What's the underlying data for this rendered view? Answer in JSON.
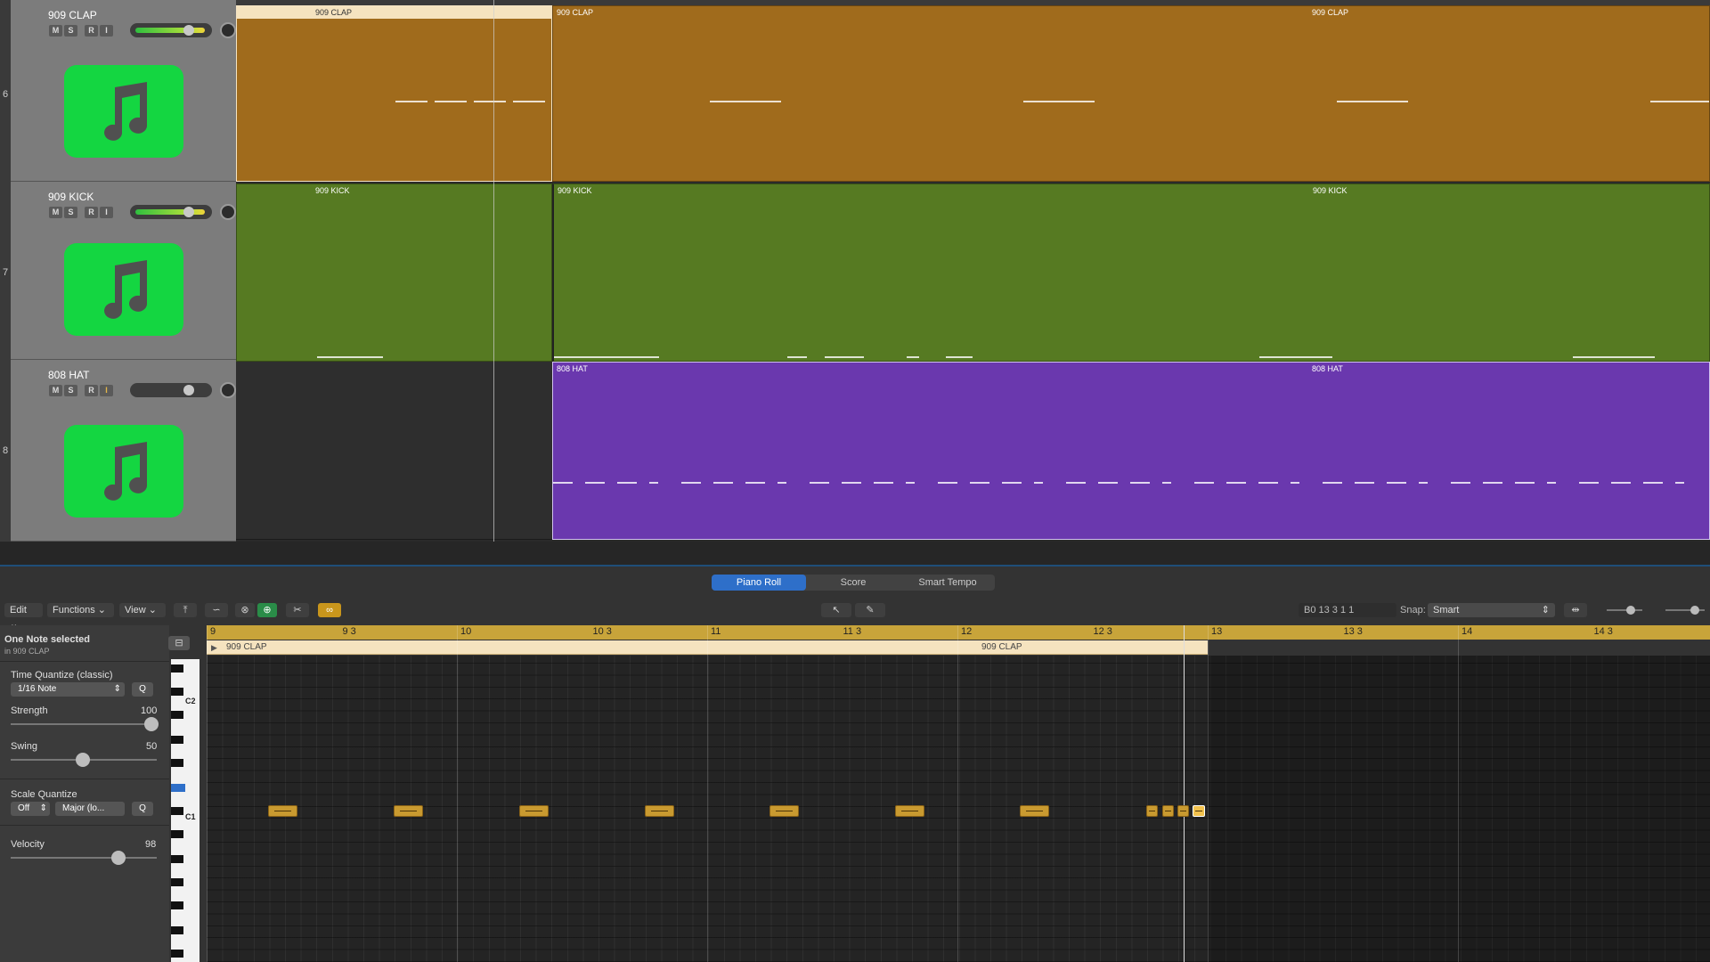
{
  "tracks": [
    {
      "number": "6",
      "name": "909 CLAP",
      "region_color": "#a06b1c",
      "region_labels": [
        "909 CLAP",
        "909 CLAP",
        "909 CLAP"
      ]
    },
    {
      "number": "7",
      "name": "909 KICK",
      "region_color": "#567a22",
      "region_labels": [
        "909 KICK",
        "909 KICK",
        "909 KICK"
      ]
    },
    {
      "number": "8",
      "name": "808 HAT",
      "region_color": "#6a38ae",
      "region_labels": [
        "808 HAT",
        "808 HAT"
      ]
    }
  ],
  "track_buttons": {
    "mute": "M",
    "solo": "S",
    "record": "R",
    "input": "I"
  },
  "editor": {
    "tabs": [
      "Piano Roll",
      "Score",
      "Smart Tempo"
    ],
    "active_tab": "Piano Roll",
    "menu": {
      "edit": "Edit",
      "functions": "Functions",
      "view": "View"
    },
    "position_readout": "B0   13 3 1 1",
    "snap_label": "Snap:",
    "snap_value": "Smart"
  },
  "inspector": {
    "selection": "One Note selected",
    "selection_sub": "in 909 CLAP",
    "time_quantize_label": "Time Quantize (classic)",
    "time_quantize_value": "1/16 Note",
    "q_button": "Q",
    "strength_label": "Strength",
    "strength_value": "100",
    "swing_label": "Swing",
    "swing_value": "50",
    "scale_quantize_label": "Scale Quantize",
    "scale_off": "Off",
    "scale_mode": "Major (lo...",
    "velocity_label": "Velocity",
    "velocity_value": "98"
  },
  "piano_roll": {
    "ruler": [
      "9",
      "9 3",
      "10",
      "10 3",
      "11",
      "11 3",
      "12",
      "12 3",
      "13",
      "13 3",
      "14",
      "14 3"
    ],
    "region_name": "909 CLAP",
    "region_name_2": "909 CLAP",
    "key_labels": [
      "C2",
      "C1"
    ]
  },
  "colors": {
    "accent": "#2e6fc9",
    "note": "#c99a30",
    "instrument_icon": "#14d641"
  }
}
